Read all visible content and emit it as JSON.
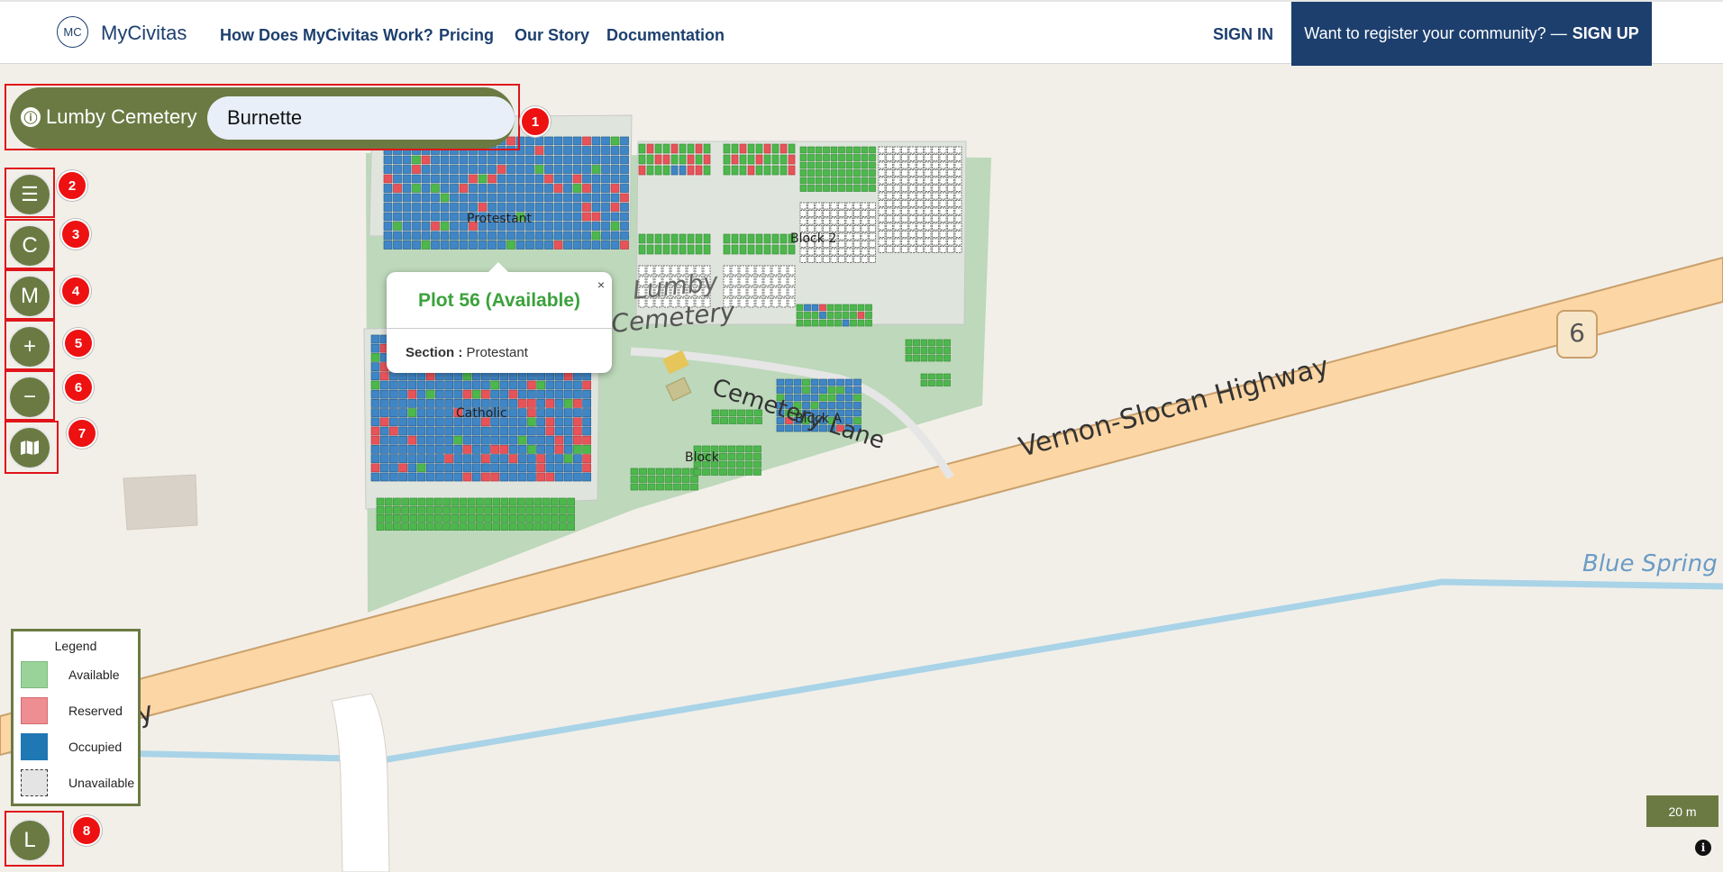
{
  "header": {
    "logo_initials": "MC",
    "brand": "MyCivitas",
    "nav": [
      "How Does MyCivitas Work?",
      "Pricing",
      "Our Story",
      "Documentation"
    ],
    "sign_in": "SIGN IN",
    "register_prompt": "Want to register your community? —",
    "register_action": "SIGN UP"
  },
  "search": {
    "info_icon": "ⓘ",
    "cemetery_name": "Lumby Cemetery",
    "query": "Burnette"
  },
  "side_buttons": [
    {
      "name": "menu",
      "glyph": "☰"
    },
    {
      "name": "c",
      "glyph": "C"
    },
    {
      "name": "m",
      "glyph": "M"
    },
    {
      "name": "zoom-in",
      "glyph": "+"
    },
    {
      "name": "zoom-out",
      "glyph": "−"
    },
    {
      "name": "basemap",
      "glyph": "map-icon"
    },
    {
      "name": "l",
      "glyph": "L"
    }
  ],
  "markers": [
    "1",
    "2",
    "3",
    "4",
    "5",
    "6",
    "7",
    "8"
  ],
  "map_labels": {
    "protestant": "Protestant",
    "catholic": "Catholic",
    "block2": "Block 2",
    "blockA": "Block A",
    "block": "Block",
    "cemetery_lumby": "Lumby",
    "cemetery_word": "Cemetery",
    "cemetery_lane": "Cemetery Lane",
    "highway": "Vernon-Slocan Highway",
    "highway_shield": "6",
    "highway_left": "y",
    "creek": "Blue Spring"
  },
  "popup": {
    "title": "Plot 56 (Available)",
    "close": "×",
    "section_label": "Section :",
    "section_value": "Protestant"
  },
  "legend": {
    "title": "Legend",
    "items": [
      {
        "label": "Available",
        "color": "#9ad39a"
      },
      {
        "label": "Reserved",
        "color": "#ee8e92"
      },
      {
        "label": "Occupied",
        "color": "#1f77b4"
      },
      {
        "label": "Unavailable",
        "color": "#e4e4e4"
      }
    ]
  },
  "scale": "20 m",
  "attribution_icon": "i",
  "colors": {
    "accent": "#6b7a43",
    "nav": "#1d3f6e",
    "available": "#4cb84c",
    "reserved": "#e8535a",
    "occupied": "#3f86c6",
    "unavailable": "#ffffff",
    "marker": "#ee1111"
  }
}
